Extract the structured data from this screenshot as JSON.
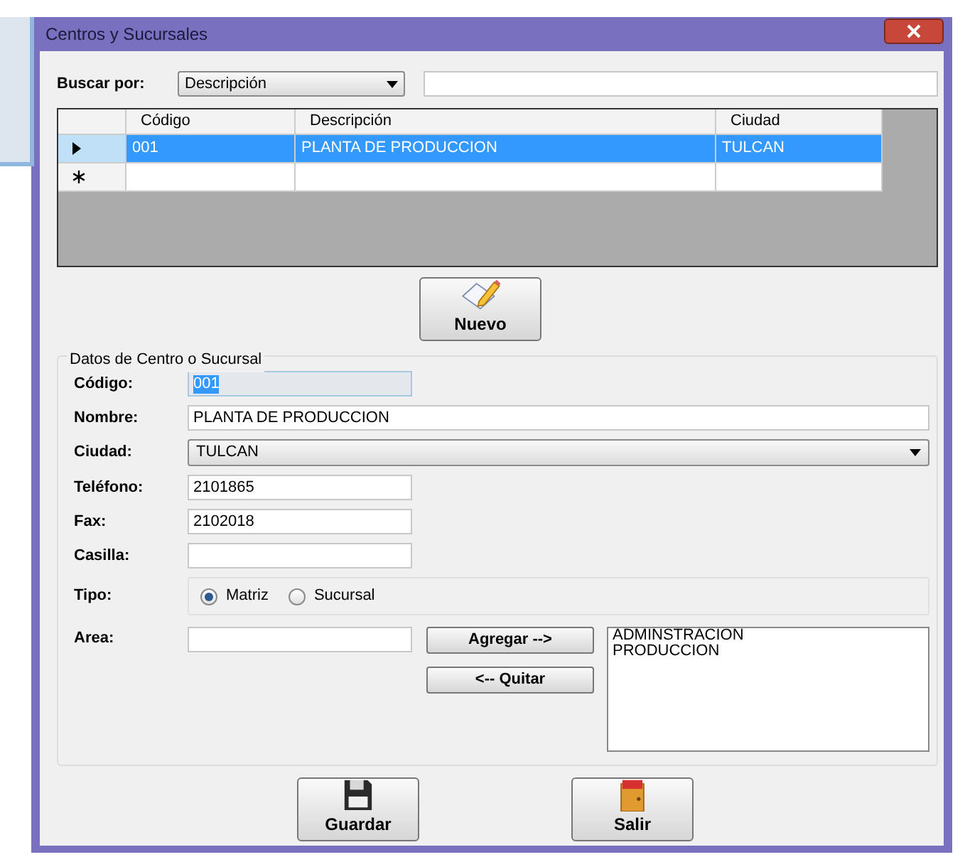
{
  "window": {
    "title": "Centros y Sucursales"
  },
  "search": {
    "label": "Buscar por:",
    "field": "Descripción"
  },
  "grid": {
    "columns": [
      "Código",
      "Descripción",
      "Ciudad"
    ],
    "rows": [
      {
        "kind": "current",
        "selected": true,
        "cells": [
          "001",
          "PLANTA DE PRODUCCION",
          "TULCAN"
        ]
      },
      {
        "kind": "new",
        "selected": false,
        "cells": [
          "",
          "",
          ""
        ]
      }
    ]
  },
  "new_button": "Nuevo",
  "details": {
    "title": "Datos de Centro o Sucursal",
    "codigo": {
      "label": "Código:",
      "value": "001",
      "disabled": true
    },
    "nombre": {
      "label": "Nombre:",
      "value": "PLANTA DE PRODUCCION"
    },
    "ciudad": {
      "label": "Ciudad:",
      "value": "TULCAN"
    },
    "telefono": {
      "label": "Teléfono:",
      "value": "2101865"
    },
    "fax": {
      "label": "Fax:",
      "value": "2102018"
    },
    "casilla": {
      "label": "Casilla:"
    },
    "tipo": {
      "label": "Tipo:",
      "options": [
        {
          "label": "Matriz",
          "selected": true
        },
        {
          "label": "Sucursal",
          "selected": false
        }
      ]
    },
    "area": {
      "label": "Area:",
      "add_button": "Agregar -->",
      "remove_button": "<-- Quitar",
      "items": [
        "ADMINSTRACION",
        "PRODUCCION"
      ]
    }
  },
  "buttons": {
    "save": "Guardar",
    "exit": "Salir"
  }
}
